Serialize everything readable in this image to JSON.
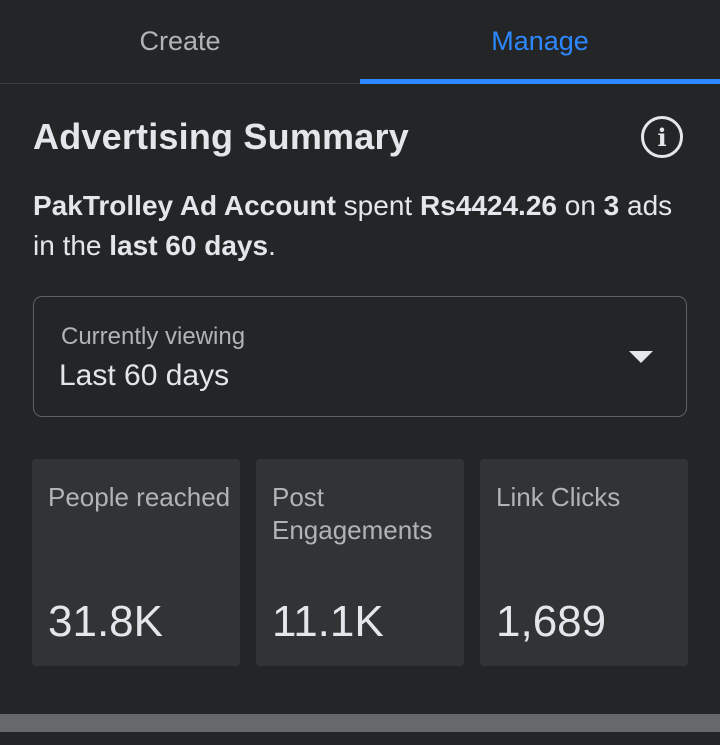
{
  "tabs": [
    {
      "label": "Create",
      "active": false
    },
    {
      "label": "Manage",
      "active": true
    }
  ],
  "summary": {
    "title": "Advertising Summary",
    "account": "PakTrolley Ad Account",
    "spent_word": " spent ",
    "amount": "Rs4424.26",
    "on_word": " on ",
    "ad_count": "3",
    "ads_text": " ads in the ",
    "period": "last 60 days",
    "end": "."
  },
  "info_icon": {
    "glyph": "i",
    "name": "info-icon"
  },
  "viewing": {
    "label": "Currently viewing",
    "value": "Last 60 days",
    "icon": "caret-down-icon"
  },
  "stats": [
    {
      "label": "People reached",
      "value": "31.8K"
    },
    {
      "label": "Post Engagements",
      "value": "11.1K"
    },
    {
      "label": "Link Clicks",
      "value": "1,689"
    }
  ],
  "colors": {
    "background": "#242526",
    "card": "#323334",
    "accent": "#2d88ff",
    "text_primary": "#e4e6eb",
    "text_secondary": "#b0b3b8"
  }
}
